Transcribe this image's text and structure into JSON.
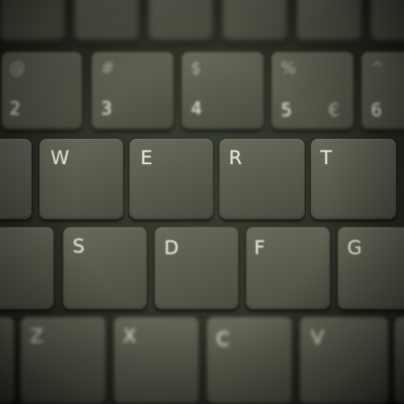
{
  "scene": {
    "subject": "laptop-keyboard-closeup",
    "palette": {
      "key_face": "#5f6256",
      "key_legend": "#e9ebdf",
      "gap": "#1e211c"
    }
  },
  "keyboard": {
    "top_row": [
      "",
      "",
      "",
      "",
      "",
      ""
    ],
    "number_row": [
      {
        "main": "2",
        "top": "@",
        "alt": ""
      },
      {
        "main": "3",
        "top": "#",
        "alt": ""
      },
      {
        "main": "4",
        "top": "$",
        "alt": ""
      },
      {
        "main": "5",
        "top": "%",
        "alt": "€"
      },
      {
        "main": "6",
        "top": "^",
        "alt": ""
      }
    ],
    "qwerty_row": [
      "",
      "W",
      "E",
      "R",
      "T"
    ],
    "asdf_row": [
      "",
      "S",
      "D",
      "F",
      "G"
    ],
    "zxcv_row": [
      "",
      "Z",
      "X",
      "C",
      "V"
    ]
  }
}
